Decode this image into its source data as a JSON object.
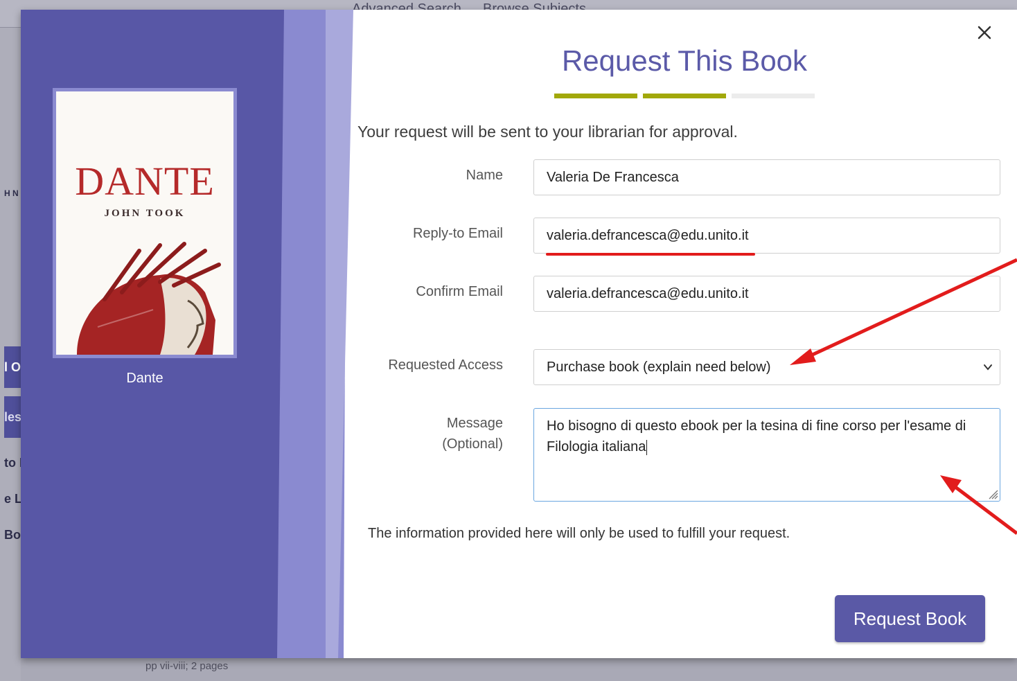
{
  "background": {
    "nav_links": [
      "Advanced Search",
      "Browse Subjects"
    ],
    "footer_text": "pp vii-viii; 2 pages",
    "strip_fragments": [
      "H N",
      "l O",
      "les",
      "to I",
      "e L",
      "Bo"
    ]
  },
  "modal": {
    "title": "Request This Book",
    "close_label": "×",
    "progress": {
      "total_steps": 3,
      "completed_steps": 2,
      "colors": {
        "done": "#a2a80a",
        "pending": "#ececec"
      }
    },
    "intro_text": "Your request will be sent to your librarian for approval.",
    "book": {
      "cover_title": "DANTE",
      "cover_author": "JOHN TOOK",
      "caption": "Dante"
    },
    "form": {
      "name": {
        "label": "Name",
        "value": "Valeria De Francesca"
      },
      "reply_email": {
        "label": "Reply-to Email",
        "value": "valeria.defrancesca@edu.unito.it"
      },
      "confirm_email": {
        "label": "Confirm Email",
        "value": "valeria.defrancesca@edu.unito.it"
      },
      "requested_access": {
        "label": "Requested Access",
        "selected": "Purchase book (explain need below)"
      },
      "message": {
        "label_line1": "Message",
        "label_line2": "(Optional)",
        "value": "Ho bisogno di questo ebook per la tesina di fine corso per l'esame di Filologia italiana"
      }
    },
    "info_text": "The information provided here will only be used to fulfill your request.",
    "submit_label": "Request Book"
  },
  "colors": {
    "accent": "#5a59a6",
    "panel": "#5857a6",
    "annotation": "#e21c1c"
  }
}
